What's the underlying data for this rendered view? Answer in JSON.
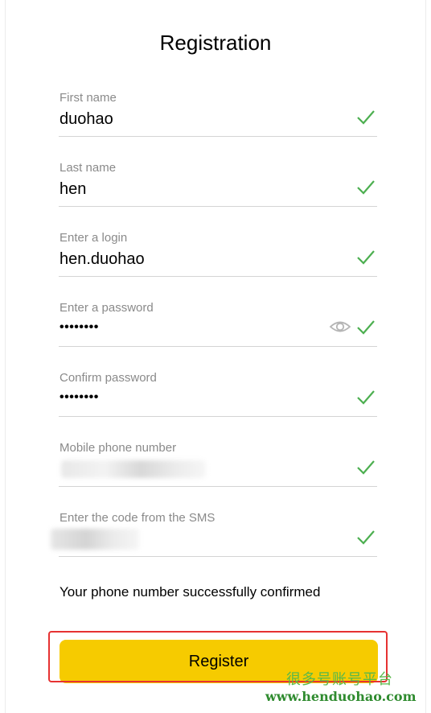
{
  "form": {
    "title": "Registration",
    "fields": [
      {
        "label": "First name",
        "value": "duohao"
      },
      {
        "label": "Last name",
        "value": "hen"
      },
      {
        "label": "Enter a login",
        "value": "hen.duohao"
      },
      {
        "label": "Enter a password",
        "value": "••••••••"
      },
      {
        "label": "Confirm password",
        "value": "••••••••"
      },
      {
        "label": "Mobile phone number",
        "value": ""
      },
      {
        "label": "Enter the code from the SMS",
        "value": ""
      }
    ],
    "confirmation_message": "Your phone number successfully confirmed",
    "register_label": "Register"
  },
  "watermark": {
    "chinese": "很多号账号平台",
    "url": "www.henduohao.com"
  },
  "colors": {
    "accent_button": "#f6cb00",
    "check": "#4caf50",
    "highlight_border": "#e63232",
    "watermark_green": "#59b84a"
  }
}
